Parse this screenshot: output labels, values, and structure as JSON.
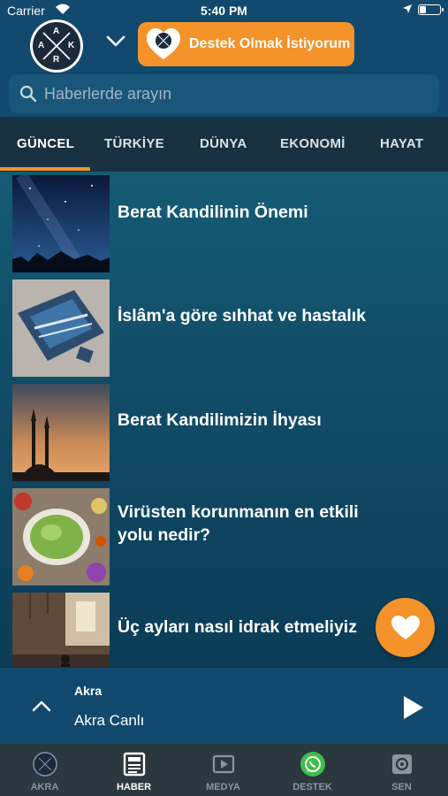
{
  "status_bar": {
    "carrier": "Carrier",
    "time": "5:40 PM"
  },
  "header": {
    "logo_letters": [
      "A",
      "K",
      "R",
      "A"
    ],
    "support_button_label": "Destek Olmak İstiyorum"
  },
  "search": {
    "placeholder": "Haberlerde arayın"
  },
  "tabs": [
    {
      "label": "GÜNCEL",
      "active": true
    },
    {
      "label": "TÜRKİYE",
      "active": false
    },
    {
      "label": "DÜNYA",
      "active": false
    },
    {
      "label": "EKONOMİ",
      "active": false
    },
    {
      "label": "HAYAT",
      "active": false
    }
  ],
  "articles": [
    {
      "title_lines": [
        "Berat Kandilinin Önemi"
      ],
      "thumbnail": "night-sky"
    },
    {
      "title_lines": [
        "İslâm'a göre sıhhat ve hastalık"
      ],
      "thumbnail": "puzzle"
    },
    {
      "title_lines": [
        "Berat Kandilimizin İhyası"
      ],
      "thumbnail": "mosque-sunset"
    },
    {
      "title_lines": [
        "Virüsten korunmanın en etkili",
        "yolu nedir?"
      ],
      "thumbnail": "food-table"
    },
    {
      "title_lines": [
        "Üç ayları nasıl idrak etmeliyiz"
      ],
      "thumbnail": "mosque-interior"
    }
  ],
  "player": {
    "channel": "Akra",
    "name": "Akra Canlı"
  },
  "nav": [
    {
      "label": "AKRA",
      "icon": "akra-logo-icon",
      "active": false
    },
    {
      "label": "HABER",
      "icon": "newspaper-icon",
      "active": true
    },
    {
      "label": "MEDYA",
      "icon": "media-icon",
      "active": false
    },
    {
      "label": "DESTEK",
      "icon": "whatsapp-icon",
      "active": false
    },
    {
      "label": "SEN",
      "icon": "settings-icon",
      "active": false
    }
  ],
  "colors": {
    "accent": "#f4932a",
    "header": "#114a6e",
    "nav": "#2c3840",
    "whatsapp": "#3fbf4a"
  }
}
